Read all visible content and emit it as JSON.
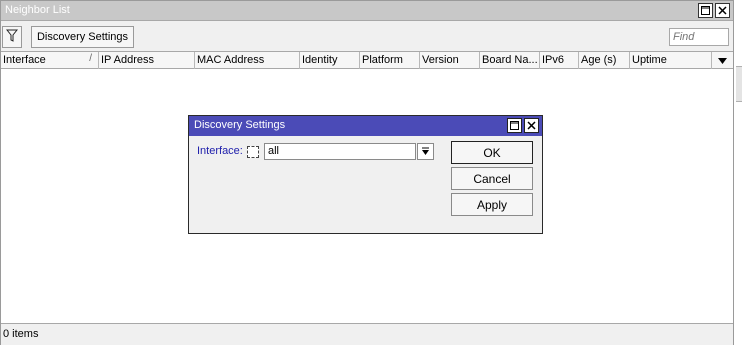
{
  "window": {
    "title": "Neighbor List",
    "restore_icon": "restore-icon",
    "close_icon": "close-icon"
  },
  "toolbar": {
    "filter_icon": "filter-icon",
    "discovery_settings_label": "Discovery Settings",
    "find_placeholder": "Find"
  },
  "table": {
    "columns": [
      "Interface",
      "IP Address",
      "MAC Address",
      "Identity",
      "Platform",
      "Version",
      "Board Na...",
      "IPv6",
      "Age (s)",
      "Uptime"
    ],
    "sort_indicator": "/",
    "column_menu_icon": "chevron-down-icon",
    "rows": []
  },
  "status": {
    "items_count": "0 items"
  },
  "dialog": {
    "title": "Discovery Settings",
    "interface_label": "Interface:",
    "interface_value": "all",
    "dropdown_icon": "dropdown-arrow-icon",
    "ok_label": "OK",
    "cancel_label": "Cancel",
    "apply_label": "Apply"
  },
  "colors": {
    "dialog_title_bg": "#4b4bb7",
    "window_title_bg": "#c8c8c8",
    "label_color": "#1d1dab"
  }
}
